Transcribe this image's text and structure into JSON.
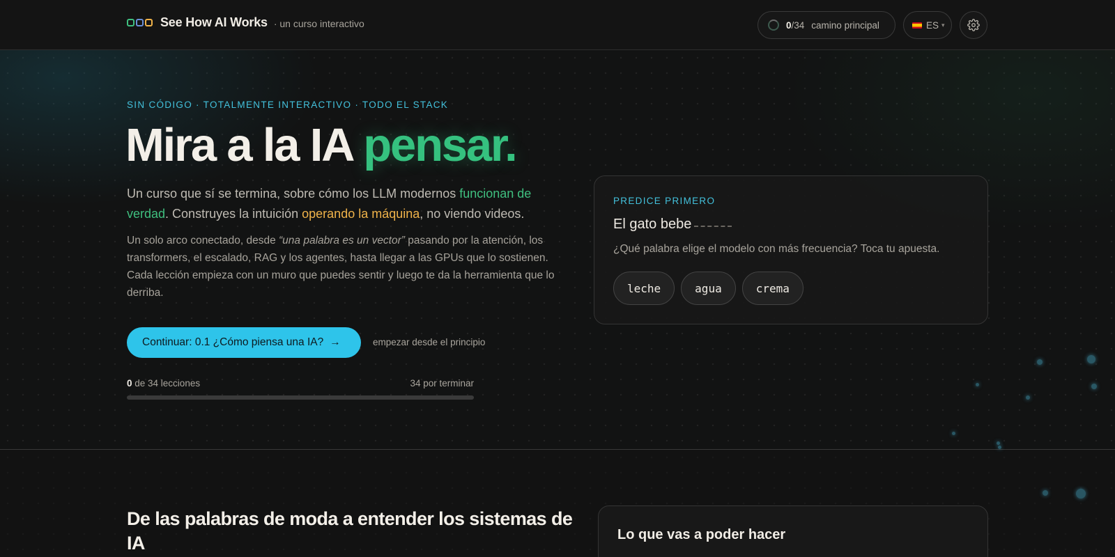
{
  "header": {
    "brand_title": "See How AI Works",
    "brand_sub": "· un curso interactivo",
    "brand_dot_colors": [
      "#3fbf7f",
      "#6a8fd8",
      "#f0b34a"
    ],
    "progress_done": "0",
    "progress_total": "/34",
    "progress_label": "camino principal",
    "lang_label": "ES",
    "lang_caret": "▾",
    "settings_icon": "gear-icon"
  },
  "hero": {
    "eyebrow": "SIN CÓDIGO · TOTALMENTE INTERACTIVO · TODO EL STACK",
    "title_main": "Mira a la IA ",
    "title_accent": "pensar.",
    "lead": {
      "p1": "Un curso que sí se termina, sobre cómo los LLM modernos ",
      "g": "funcionan de verdad",
      "p2": ". Construyes la intuición ",
      "o": "operando la máquina",
      "p3": ", no viendo videos."
    },
    "body": {
      "p1": "Un solo arco conectado, desde ",
      "em": "“una palabra es un vector”",
      "p2": " pasando por la atención, los transformers, el escalado, RAG y los agentes, hasta llegar a las GPUs que lo sostienen. Cada lección empieza con un muro que puedes sentir y luego te da la herramienta que lo derriba."
    },
    "cta_label": "Continuar: 0.1 ¿Cómo piensa una IA?",
    "cta_arrow": "→",
    "restart_label": "empezar desde el principio",
    "lessons_done": "0",
    "lessons_total_text": " de 34 lecciones",
    "lessons_remaining": "34 por terminar",
    "progress_fraction": 0,
    "accent_color": "#2ec4ea"
  },
  "predict_card": {
    "eyebrow": "PREDICE PRIMERO",
    "sentence": "El gato bebe",
    "question": "¿Qué palabra elige el modelo con más frecuencia? Toca tu apuesta.",
    "options": [
      "leche",
      "agua",
      "crema"
    ]
  },
  "section2": {
    "title": "De las palabras de moda a entender los sistemas de IA",
    "card_title": "Lo que vas a poder hacer"
  }
}
